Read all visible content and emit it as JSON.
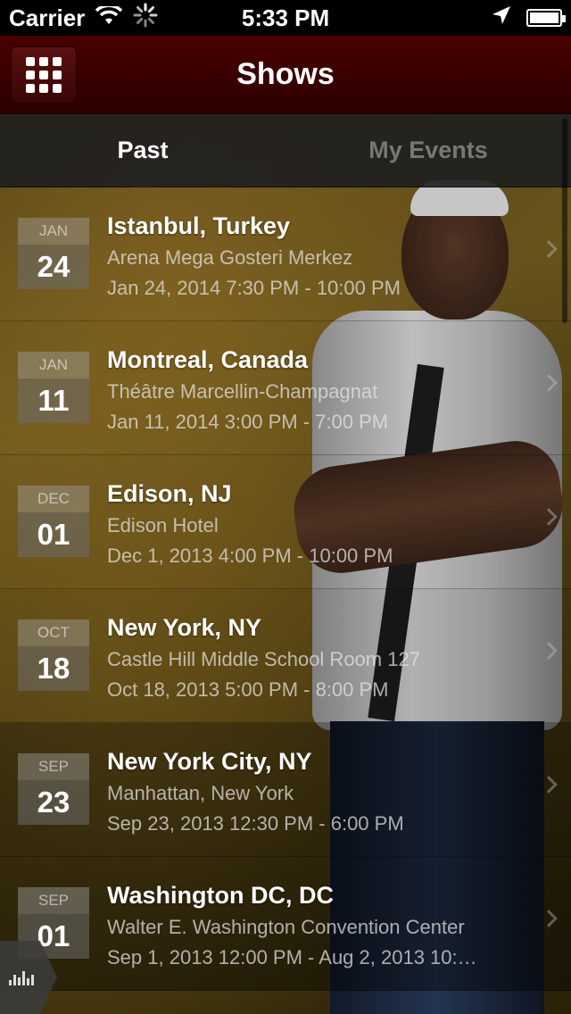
{
  "status_bar": {
    "carrier": "Carrier",
    "time": "5:33 PM"
  },
  "nav": {
    "title": "Shows",
    "menu_icon": "grid-icon"
  },
  "tabs": [
    {
      "label": "Past",
      "active": true
    },
    {
      "label": "My Events",
      "active": false
    }
  ],
  "events": [
    {
      "month": "JAN",
      "day": "24",
      "title": "Istanbul, Turkey",
      "venue": "Arena Mega Gosteri Merkez",
      "time": "Jan 24, 2014 7:30 PM - 10:00 PM"
    },
    {
      "month": "JAN",
      "day": "11",
      "title": "Montreal, Canada",
      "venue": "Théâtre Marcellin-Champagnat",
      "time": "Jan 11, 2014 3:00 PM - 7:00 PM"
    },
    {
      "month": "DEC",
      "day": "01",
      "title": "Edison, NJ",
      "venue": "Edison Hotel",
      "time": "Dec 1, 2013 4:00 PM - 10:00 PM"
    },
    {
      "month": "OCT",
      "day": "18",
      "title": "New York, NY",
      "venue": "Castle Hill Middle School Room 127",
      "time": "Oct 18, 2013 5:00 PM - 8:00 PM"
    },
    {
      "month": "SEP",
      "day": "23",
      "title": "New York City, NY",
      "venue": "Manhattan, New York",
      "time": "Sep 23, 2013 12:30 PM - 6:00 PM"
    },
    {
      "month": "SEP",
      "day": "01",
      "title": "Washington DC, DC",
      "venue": "Walter E. Washington Convention Center",
      "time": "Sep 1, 2013 12:00 PM - Aug 2, 2013 10:…"
    }
  ],
  "colors": {
    "nav_background": "#3a0000",
    "tab_active": "#ffffff",
    "tab_inactive": "#777777"
  }
}
